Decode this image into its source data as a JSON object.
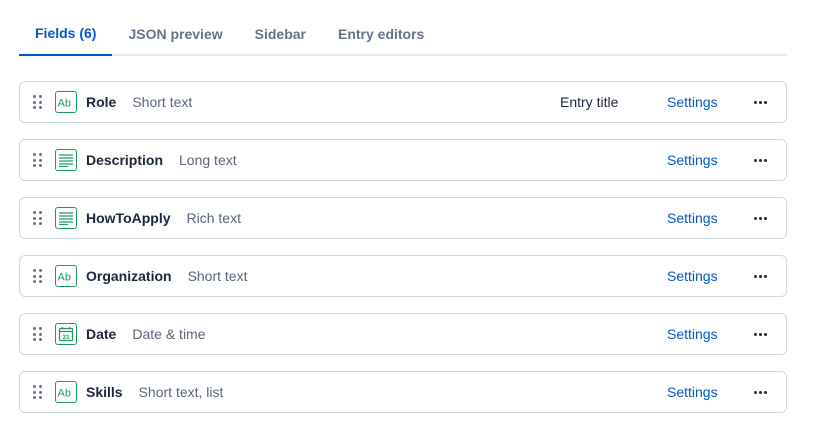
{
  "tabs": [
    {
      "label": "Fields (6)",
      "active": true
    },
    {
      "label": "JSON preview",
      "active": false
    },
    {
      "label": "Sidebar",
      "active": false
    },
    {
      "label": "Entry editors",
      "active": false
    }
  ],
  "settings_label": "Settings",
  "colors": {
    "accent": "#0059c8",
    "icon_green": "#1a9a5f",
    "border": "#cfd9e0"
  },
  "fields": [
    {
      "name": "Role",
      "type": "Short text",
      "icon": "short-text-icon",
      "badge": "Entry title"
    },
    {
      "name": "Description",
      "type": "Long text",
      "icon": "long-text-icon",
      "badge": ""
    },
    {
      "name": "HowToApply",
      "type": "Rich text",
      "icon": "rich-text-icon",
      "badge": ""
    },
    {
      "name": "Organization",
      "type": "Short text",
      "icon": "short-text-icon",
      "badge": ""
    },
    {
      "name": "Date",
      "type": "Date & time",
      "icon": "calendar-icon",
      "badge": ""
    },
    {
      "name": "Skills",
      "type": "Short text, list",
      "icon": "short-text-icon",
      "badge": ""
    }
  ]
}
